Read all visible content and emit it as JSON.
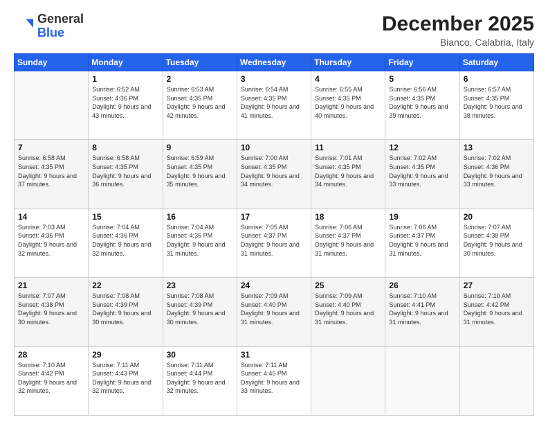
{
  "header": {
    "logo_general": "General",
    "logo_blue": "Blue",
    "month_title": "December 2025",
    "location": "Bianco, Calabria, Italy"
  },
  "days_of_week": [
    "Sunday",
    "Monday",
    "Tuesday",
    "Wednesday",
    "Thursday",
    "Friday",
    "Saturday"
  ],
  "weeks": [
    [
      {
        "day": "",
        "sunrise": "",
        "sunset": "",
        "daylight": ""
      },
      {
        "day": "1",
        "sunrise": "Sunrise: 6:52 AM",
        "sunset": "Sunset: 4:36 PM",
        "daylight": "Daylight: 9 hours and 43 minutes."
      },
      {
        "day": "2",
        "sunrise": "Sunrise: 6:53 AM",
        "sunset": "Sunset: 4:35 PM",
        "daylight": "Daylight: 9 hours and 42 minutes."
      },
      {
        "day": "3",
        "sunrise": "Sunrise: 6:54 AM",
        "sunset": "Sunset: 4:35 PM",
        "daylight": "Daylight: 9 hours and 41 minutes."
      },
      {
        "day": "4",
        "sunrise": "Sunrise: 6:55 AM",
        "sunset": "Sunset: 4:35 PM",
        "daylight": "Daylight: 9 hours and 40 minutes."
      },
      {
        "day": "5",
        "sunrise": "Sunrise: 6:56 AM",
        "sunset": "Sunset: 4:35 PM",
        "daylight": "Daylight: 9 hours and 39 minutes."
      },
      {
        "day": "6",
        "sunrise": "Sunrise: 6:57 AM",
        "sunset": "Sunset: 4:35 PM",
        "daylight": "Daylight: 9 hours and 38 minutes."
      }
    ],
    [
      {
        "day": "7",
        "sunrise": "Sunrise: 6:58 AM",
        "sunset": "Sunset: 4:35 PM",
        "daylight": "Daylight: 9 hours and 37 minutes."
      },
      {
        "day": "8",
        "sunrise": "Sunrise: 6:58 AM",
        "sunset": "Sunset: 4:35 PM",
        "daylight": "Daylight: 9 hours and 36 minutes."
      },
      {
        "day": "9",
        "sunrise": "Sunrise: 6:59 AM",
        "sunset": "Sunset: 4:35 PM",
        "daylight": "Daylight: 9 hours and 35 minutes."
      },
      {
        "day": "10",
        "sunrise": "Sunrise: 7:00 AM",
        "sunset": "Sunset: 4:35 PM",
        "daylight": "Daylight: 9 hours and 34 minutes."
      },
      {
        "day": "11",
        "sunrise": "Sunrise: 7:01 AM",
        "sunset": "Sunset: 4:35 PM",
        "daylight": "Daylight: 9 hours and 34 minutes."
      },
      {
        "day": "12",
        "sunrise": "Sunrise: 7:02 AM",
        "sunset": "Sunset: 4:35 PM",
        "daylight": "Daylight: 9 hours and 33 minutes."
      },
      {
        "day": "13",
        "sunrise": "Sunrise: 7:02 AM",
        "sunset": "Sunset: 4:36 PM",
        "daylight": "Daylight: 9 hours and 33 minutes."
      }
    ],
    [
      {
        "day": "14",
        "sunrise": "Sunrise: 7:03 AM",
        "sunset": "Sunset: 4:36 PM",
        "daylight": "Daylight: 9 hours and 32 minutes."
      },
      {
        "day": "15",
        "sunrise": "Sunrise: 7:04 AM",
        "sunset": "Sunset: 4:36 PM",
        "daylight": "Daylight: 9 hours and 32 minutes."
      },
      {
        "day": "16",
        "sunrise": "Sunrise: 7:04 AM",
        "sunset": "Sunset: 4:36 PM",
        "daylight": "Daylight: 9 hours and 31 minutes."
      },
      {
        "day": "17",
        "sunrise": "Sunrise: 7:05 AM",
        "sunset": "Sunset: 4:37 PM",
        "daylight": "Daylight: 9 hours and 31 minutes."
      },
      {
        "day": "18",
        "sunrise": "Sunrise: 7:06 AM",
        "sunset": "Sunset: 4:37 PM",
        "daylight": "Daylight: 9 hours and 31 minutes."
      },
      {
        "day": "19",
        "sunrise": "Sunrise: 7:06 AM",
        "sunset": "Sunset: 4:37 PM",
        "daylight": "Daylight: 9 hours and 31 minutes."
      },
      {
        "day": "20",
        "sunrise": "Sunrise: 7:07 AM",
        "sunset": "Sunset: 4:38 PM",
        "daylight": "Daylight: 9 hours and 30 minutes."
      }
    ],
    [
      {
        "day": "21",
        "sunrise": "Sunrise: 7:07 AM",
        "sunset": "Sunset: 4:38 PM",
        "daylight": "Daylight: 9 hours and 30 minutes."
      },
      {
        "day": "22",
        "sunrise": "Sunrise: 7:08 AM",
        "sunset": "Sunset: 4:39 PM",
        "daylight": "Daylight: 9 hours and 30 minutes."
      },
      {
        "day": "23",
        "sunrise": "Sunrise: 7:08 AM",
        "sunset": "Sunset: 4:39 PM",
        "daylight": "Daylight: 9 hours and 30 minutes."
      },
      {
        "day": "24",
        "sunrise": "Sunrise: 7:09 AM",
        "sunset": "Sunset: 4:40 PM",
        "daylight": "Daylight: 9 hours and 31 minutes."
      },
      {
        "day": "25",
        "sunrise": "Sunrise: 7:09 AM",
        "sunset": "Sunset: 4:40 PM",
        "daylight": "Daylight: 9 hours and 31 minutes."
      },
      {
        "day": "26",
        "sunrise": "Sunrise: 7:10 AM",
        "sunset": "Sunset: 4:41 PM",
        "daylight": "Daylight: 9 hours and 31 minutes."
      },
      {
        "day": "27",
        "sunrise": "Sunrise: 7:10 AM",
        "sunset": "Sunset: 4:42 PM",
        "daylight": "Daylight: 9 hours and 31 minutes."
      }
    ],
    [
      {
        "day": "28",
        "sunrise": "Sunrise: 7:10 AM",
        "sunset": "Sunset: 4:42 PM",
        "daylight": "Daylight: 9 hours and 32 minutes."
      },
      {
        "day": "29",
        "sunrise": "Sunrise: 7:11 AM",
        "sunset": "Sunset: 4:43 PM",
        "daylight": "Daylight: 9 hours and 32 minutes."
      },
      {
        "day": "30",
        "sunrise": "Sunrise: 7:11 AM",
        "sunset": "Sunset: 4:44 PM",
        "daylight": "Daylight: 9 hours and 32 minutes."
      },
      {
        "day": "31",
        "sunrise": "Sunrise: 7:11 AM",
        "sunset": "Sunset: 4:45 PM",
        "daylight": "Daylight: 9 hours and 33 minutes."
      },
      {
        "day": "",
        "sunrise": "",
        "sunset": "",
        "daylight": ""
      },
      {
        "day": "",
        "sunrise": "",
        "sunset": "",
        "daylight": ""
      },
      {
        "day": "",
        "sunrise": "",
        "sunset": "",
        "daylight": ""
      }
    ]
  ]
}
